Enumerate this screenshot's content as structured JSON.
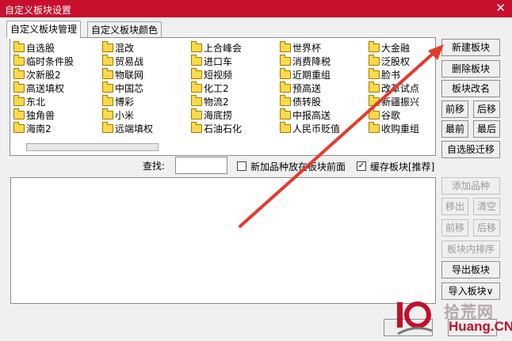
{
  "window": {
    "title": "自定义板块设置",
    "close_glyph": "✕"
  },
  "tabs": [
    "自定义板块管理",
    "自定义板块颜色"
  ],
  "blocks": [
    [
      "自选股",
      "临时条件股",
      "次新股2",
      "高送填权",
      "东北",
      "独角兽",
      "海南2"
    ],
    [
      "混改",
      "贸易战",
      "物联网",
      "中国芯",
      "博彩",
      "小米",
      "远端填权"
    ],
    [
      "上合峰会",
      "进口车",
      "短视频",
      "化工2",
      "物流2",
      "海底捞",
      "石油石化"
    ],
    [
      "世界杯",
      "消费降税",
      "近期重组",
      "预高送",
      "债转股",
      "中报高送",
      "人民币贬值"
    ],
    [
      "大金融",
      "泛股权",
      "脸书",
      "改革试点",
      "新疆振兴",
      "谷歌",
      "收购重组"
    ]
  ],
  "search": {
    "label": "查找:",
    "value": ""
  },
  "options": {
    "add_front": {
      "label": "新加品种放在板块前面",
      "checked": false
    },
    "save_block": {
      "label": "缓存板块[推荐]",
      "checked": true,
      "check_glyph": "✓"
    }
  },
  "buttons": {
    "new": "新建板块",
    "delete": "删除板块",
    "rename": "板块改名",
    "move_up": "前移",
    "move_down": "后移",
    "first": "最前",
    "last": "最后",
    "migrate": "自选股迁移",
    "add_item": "添加品种",
    "remove": "移出",
    "clear": "清空",
    "item_up": "前移",
    "item_down": "后移",
    "sort": "板块内排序",
    "export": "导出板块",
    "import": "导入板块∨"
  },
  "watermark": {
    "logo": "10",
    "site": "拾荒网",
    "domain": "Huang.CN"
  },
  "colors": {
    "title_bar": "#c8102e",
    "arrow": "#e53a2a"
  }
}
